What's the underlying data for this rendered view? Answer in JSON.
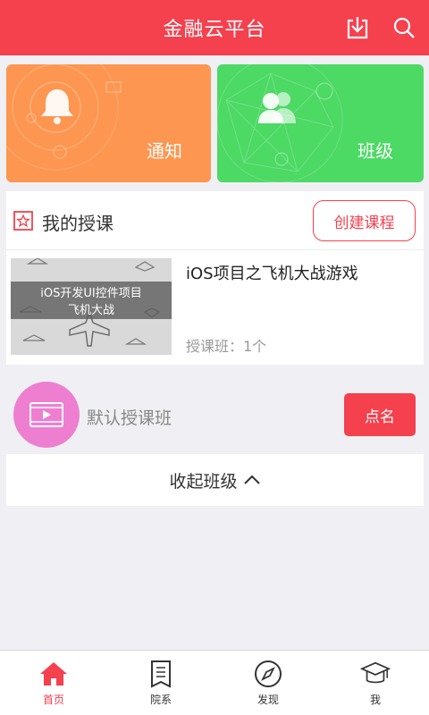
{
  "header": {
    "title": "金融云平台",
    "icons": [
      "download-icon",
      "search-icon"
    ]
  },
  "cards": {
    "notice": {
      "label": "通知",
      "icon": "bell-icon",
      "color": "#fd9650"
    },
    "class": {
      "label": "班级",
      "icon": "users-icon",
      "color": "#4cd964"
    }
  },
  "my_courses": {
    "title": "我的授课",
    "create_label": "创建课程",
    "course": {
      "thumb_line1": "iOS开发UI控件项目",
      "thumb_line2": "飞机大战",
      "name": "iOS项目之飞机大战游戏",
      "meta": "授课班：1个"
    }
  },
  "default_class": {
    "name": "默认授课班",
    "rollcall_label": "点名",
    "icon": "video-icon"
  },
  "collapse": {
    "label": "收起班级"
  },
  "nav": {
    "items": [
      {
        "label": "首页",
        "icon": "home-icon",
        "active": true
      },
      {
        "label": "院系",
        "icon": "list-icon",
        "active": false
      },
      {
        "label": "发现",
        "icon": "compass-icon",
        "active": false
      },
      {
        "label": "我",
        "icon": "graduation-cap-icon",
        "active": false
      }
    ]
  },
  "colors": {
    "accent": "#f5404e",
    "background": "#f0f0f4"
  }
}
